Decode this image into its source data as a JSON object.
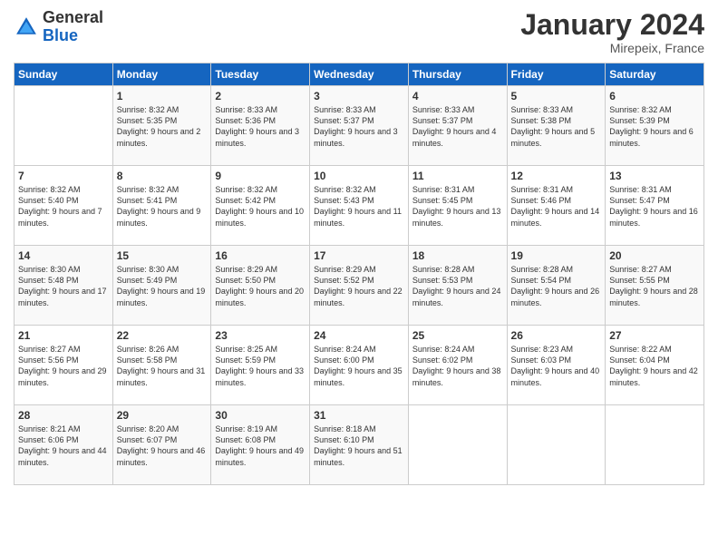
{
  "logo": {
    "line1": "General",
    "line2": "Blue"
  },
  "title": "January 2024",
  "location": "Mirepeix, France",
  "days_of_week": [
    "Sunday",
    "Monday",
    "Tuesday",
    "Wednesday",
    "Thursday",
    "Friday",
    "Saturday"
  ],
  "weeks": [
    [
      {
        "day": "",
        "sunrise": "",
        "sunset": "",
        "daylight": ""
      },
      {
        "day": "1",
        "sunrise": "Sunrise: 8:32 AM",
        "sunset": "Sunset: 5:35 PM",
        "daylight": "Daylight: 9 hours and 2 minutes."
      },
      {
        "day": "2",
        "sunrise": "Sunrise: 8:33 AM",
        "sunset": "Sunset: 5:36 PM",
        "daylight": "Daylight: 9 hours and 3 minutes."
      },
      {
        "day": "3",
        "sunrise": "Sunrise: 8:33 AM",
        "sunset": "Sunset: 5:37 PM",
        "daylight": "Daylight: 9 hours and 3 minutes."
      },
      {
        "day": "4",
        "sunrise": "Sunrise: 8:33 AM",
        "sunset": "Sunset: 5:37 PM",
        "daylight": "Daylight: 9 hours and 4 minutes."
      },
      {
        "day": "5",
        "sunrise": "Sunrise: 8:33 AM",
        "sunset": "Sunset: 5:38 PM",
        "daylight": "Daylight: 9 hours and 5 minutes."
      },
      {
        "day": "6",
        "sunrise": "Sunrise: 8:32 AM",
        "sunset": "Sunset: 5:39 PM",
        "daylight": "Daylight: 9 hours and 6 minutes."
      }
    ],
    [
      {
        "day": "7",
        "sunrise": "Sunrise: 8:32 AM",
        "sunset": "Sunset: 5:40 PM",
        "daylight": "Daylight: 9 hours and 7 minutes."
      },
      {
        "day": "8",
        "sunrise": "Sunrise: 8:32 AM",
        "sunset": "Sunset: 5:41 PM",
        "daylight": "Daylight: 9 hours and 9 minutes."
      },
      {
        "day": "9",
        "sunrise": "Sunrise: 8:32 AM",
        "sunset": "Sunset: 5:42 PM",
        "daylight": "Daylight: 9 hours and 10 minutes."
      },
      {
        "day": "10",
        "sunrise": "Sunrise: 8:32 AM",
        "sunset": "Sunset: 5:43 PM",
        "daylight": "Daylight: 9 hours and 11 minutes."
      },
      {
        "day": "11",
        "sunrise": "Sunrise: 8:31 AM",
        "sunset": "Sunset: 5:45 PM",
        "daylight": "Daylight: 9 hours and 13 minutes."
      },
      {
        "day": "12",
        "sunrise": "Sunrise: 8:31 AM",
        "sunset": "Sunset: 5:46 PM",
        "daylight": "Daylight: 9 hours and 14 minutes."
      },
      {
        "day": "13",
        "sunrise": "Sunrise: 8:31 AM",
        "sunset": "Sunset: 5:47 PM",
        "daylight": "Daylight: 9 hours and 16 minutes."
      }
    ],
    [
      {
        "day": "14",
        "sunrise": "Sunrise: 8:30 AM",
        "sunset": "Sunset: 5:48 PM",
        "daylight": "Daylight: 9 hours and 17 minutes."
      },
      {
        "day": "15",
        "sunrise": "Sunrise: 8:30 AM",
        "sunset": "Sunset: 5:49 PM",
        "daylight": "Daylight: 9 hours and 19 minutes."
      },
      {
        "day": "16",
        "sunrise": "Sunrise: 8:29 AM",
        "sunset": "Sunset: 5:50 PM",
        "daylight": "Daylight: 9 hours and 20 minutes."
      },
      {
        "day": "17",
        "sunrise": "Sunrise: 8:29 AM",
        "sunset": "Sunset: 5:52 PM",
        "daylight": "Daylight: 9 hours and 22 minutes."
      },
      {
        "day": "18",
        "sunrise": "Sunrise: 8:28 AM",
        "sunset": "Sunset: 5:53 PM",
        "daylight": "Daylight: 9 hours and 24 minutes."
      },
      {
        "day": "19",
        "sunrise": "Sunrise: 8:28 AM",
        "sunset": "Sunset: 5:54 PM",
        "daylight": "Daylight: 9 hours and 26 minutes."
      },
      {
        "day": "20",
        "sunrise": "Sunrise: 8:27 AM",
        "sunset": "Sunset: 5:55 PM",
        "daylight": "Daylight: 9 hours and 28 minutes."
      }
    ],
    [
      {
        "day": "21",
        "sunrise": "Sunrise: 8:27 AM",
        "sunset": "Sunset: 5:56 PM",
        "daylight": "Daylight: 9 hours and 29 minutes."
      },
      {
        "day": "22",
        "sunrise": "Sunrise: 8:26 AM",
        "sunset": "Sunset: 5:58 PM",
        "daylight": "Daylight: 9 hours and 31 minutes."
      },
      {
        "day": "23",
        "sunrise": "Sunrise: 8:25 AM",
        "sunset": "Sunset: 5:59 PM",
        "daylight": "Daylight: 9 hours and 33 minutes."
      },
      {
        "day": "24",
        "sunrise": "Sunrise: 8:24 AM",
        "sunset": "Sunset: 6:00 PM",
        "daylight": "Daylight: 9 hours and 35 minutes."
      },
      {
        "day": "25",
        "sunrise": "Sunrise: 8:24 AM",
        "sunset": "Sunset: 6:02 PM",
        "daylight": "Daylight: 9 hours and 38 minutes."
      },
      {
        "day": "26",
        "sunrise": "Sunrise: 8:23 AM",
        "sunset": "Sunset: 6:03 PM",
        "daylight": "Daylight: 9 hours and 40 minutes."
      },
      {
        "day": "27",
        "sunrise": "Sunrise: 8:22 AM",
        "sunset": "Sunset: 6:04 PM",
        "daylight": "Daylight: 9 hours and 42 minutes."
      }
    ],
    [
      {
        "day": "28",
        "sunrise": "Sunrise: 8:21 AM",
        "sunset": "Sunset: 6:06 PM",
        "daylight": "Daylight: 9 hours and 44 minutes."
      },
      {
        "day": "29",
        "sunrise": "Sunrise: 8:20 AM",
        "sunset": "Sunset: 6:07 PM",
        "daylight": "Daylight: 9 hours and 46 minutes."
      },
      {
        "day": "30",
        "sunrise": "Sunrise: 8:19 AM",
        "sunset": "Sunset: 6:08 PM",
        "daylight": "Daylight: 9 hours and 49 minutes."
      },
      {
        "day": "31",
        "sunrise": "Sunrise: 8:18 AM",
        "sunset": "Sunset: 6:10 PM",
        "daylight": "Daylight: 9 hours and 51 minutes."
      },
      {
        "day": "",
        "sunrise": "",
        "sunset": "",
        "daylight": ""
      },
      {
        "day": "",
        "sunrise": "",
        "sunset": "",
        "daylight": ""
      },
      {
        "day": "",
        "sunrise": "",
        "sunset": "",
        "daylight": ""
      }
    ]
  ]
}
